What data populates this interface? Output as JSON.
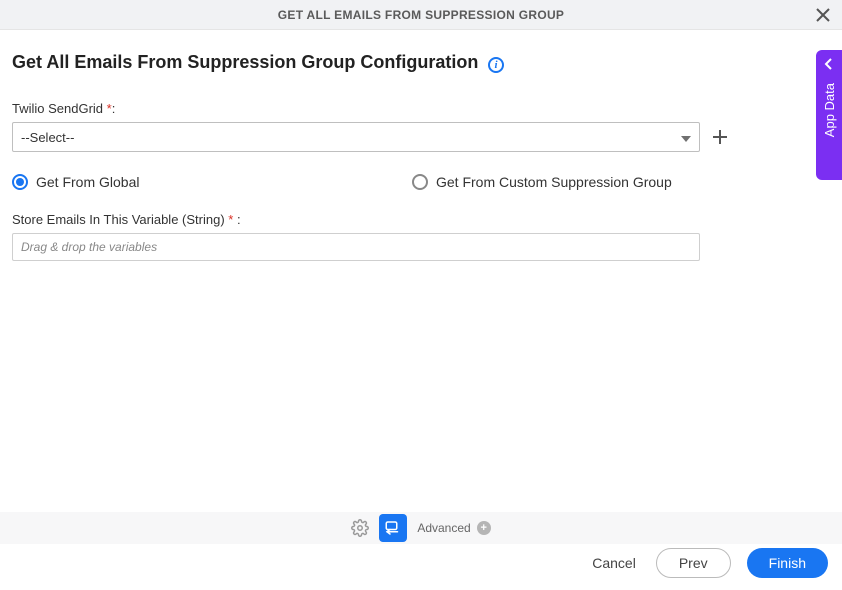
{
  "header": {
    "title": "GET ALL EMAILS FROM SUPPRESSION GROUP"
  },
  "page": {
    "title": "Get All Emails From Suppression Group Configuration"
  },
  "twilio": {
    "label": "Twilio SendGrid ",
    "required": "*",
    "colon": ":",
    "selected": "--Select--"
  },
  "radios": {
    "global": "Get From Global",
    "custom": "Get From Custom Suppression Group"
  },
  "storeVar": {
    "label": "Store Emails In This Variable (String) ",
    "required": "*",
    "colon": " :",
    "placeholder": "Drag & drop the variables"
  },
  "footer": {
    "advanced": "Advanced",
    "cancel": "Cancel",
    "prev": "Prev",
    "finish": "Finish"
  },
  "sidebar": {
    "label": "App Data"
  }
}
